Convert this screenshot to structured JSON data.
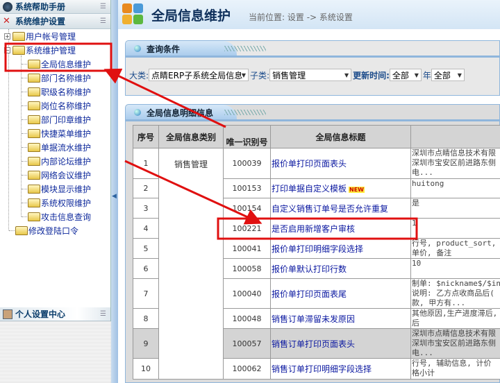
{
  "sidebar": {
    "help_header": "系统帮助手册",
    "settings_header": "系统维护设置",
    "personal_header": "个人设置中心",
    "tree": {
      "user_accounts": "用户帐号管理",
      "system_maintenance": "系统维护管理",
      "children": [
        "全局信息维护",
        "部门名称维护",
        "职级名称维护",
        "岗位名称维护",
        "部门印章维护",
        "快捷菜单维护",
        "单据流水维护",
        "内部论坛维护",
        "网络会议维护",
        "模块显示维护",
        "系统权限维护",
        "攻击信息查询"
      ],
      "change_password": "修改登陆口令"
    }
  },
  "header": {
    "title": "全局信息维护",
    "breadcrumb": "当前位置: 设置 -> 系统设置"
  },
  "query": {
    "tab": "查询条件",
    "category_label": "大类:",
    "category_value": "点睛ERP子系统全局信息",
    "subcategory_label": "子类:",
    "subcategory_value": "销售管理",
    "update_label": "更新时间:",
    "year_value": "全部",
    "year_label": "年",
    "month_value": "全部"
  },
  "detail": {
    "tab": "全局信息明细信息",
    "columns": [
      "序号",
      "全局信息类别",
      "唯一识别号",
      "全局信息标题",
      ""
    ],
    "category": "销售管理",
    "new_badge": "NEW",
    "rows": [
      {
        "no": "1",
        "id": "100039",
        "title": "报价单打印页面表头",
        "value": "深圳市点睛信息技术有限\n深圳市宝安区前进路东侧\n电..."
      },
      {
        "no": "2",
        "id": "100153",
        "title": "打印单据自定义模板",
        "value": "huitong"
      },
      {
        "no": "3",
        "id": "100154",
        "title": "自定义销售订单号是否允许重复",
        "value": "是"
      },
      {
        "no": "4",
        "id": "100221",
        "title": "是否启用新增客户审核",
        "value": "1"
      },
      {
        "no": "5",
        "id": "100041",
        "title": "报价单打印明细字段选择",
        "value": "行号, product_sort, bu\n单价, 备注"
      },
      {
        "no": "6",
        "id": "100058",
        "title": "报价单默认打印行数",
        "value": "10"
      },
      {
        "no": "7",
        "id": "100040",
        "title": "报价单打印页面表尾",
        "value": "制单: $nickname$/$inpu\n说明: 乙方点收商品后(\n款, 甲方有..."
      },
      {
        "no": "8",
        "id": "100048",
        "title": "销售订单滞留未发原因",
        "value": "其他原因,生产进度滞后,\n后"
      },
      {
        "no": "9",
        "id": "100057",
        "title": "销售订单打印页面表头",
        "value": "深圳市点睛信息技术有限\n深圳市宝安区前进路东侧\n电..."
      },
      {
        "no": "10",
        "id": "100062",
        "title": "销售订单打印明细字段选择",
        "value": "行号, 辅助信息, 计价\n格小计"
      }
    ]
  },
  "annotation_color": "#e01010"
}
